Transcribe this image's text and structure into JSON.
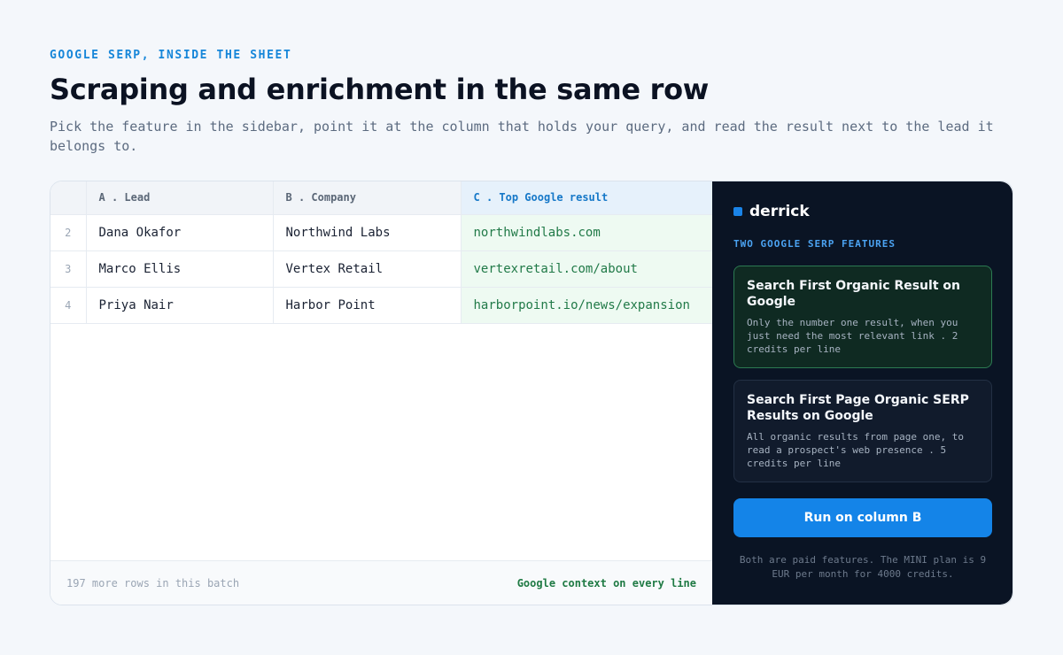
{
  "header": {
    "eyebrow": "GOOGLE SERP, INSIDE THE SHEET",
    "title": "Scraping and enrichment in the same row",
    "subtitle": "Pick the feature in the sidebar, point it at the column that holds your query, and read the result next to the lead it belongs to."
  },
  "sheet": {
    "columns": [
      "A . Lead",
      "B . Company",
      "C . Top Google result"
    ],
    "rows": [
      {
        "num": "2",
        "lead": "Dana Okafor",
        "company": "Northwind Labs",
        "result": "northwindlabs.com"
      },
      {
        "num": "3",
        "lead": "Marco Ellis",
        "company": "Vertex Retail",
        "result": "vertexretail.com/about"
      },
      {
        "num": "4",
        "lead": "Priya Nair",
        "company": "Harbor Point",
        "result": "harborpoint.io/news/expansion"
      }
    ],
    "footer_left": "197 more rows in this batch",
    "footer_right": "Google context on every line"
  },
  "panel": {
    "brand": "derrick",
    "label": "TWO GOOGLE SERP FEATURES",
    "cards": [
      {
        "title": "Search First Organic Result on Google",
        "desc": "Only the number one result, when you just need the most relevant link . 2 credits per line"
      },
      {
        "title": "Search First Page Organic SERP Results on Google",
        "desc": "All organic results from page one, to read a prospect's web presence . 5 credits per line"
      }
    ],
    "button": "Run on column B",
    "note": "Both are paid features. The MINI plan is 9 EUR per month for 4000 credits."
  },
  "colors": {
    "accent": "#1484e8",
    "result_green": "#217a48",
    "panel_bg": "#0a1424"
  }
}
